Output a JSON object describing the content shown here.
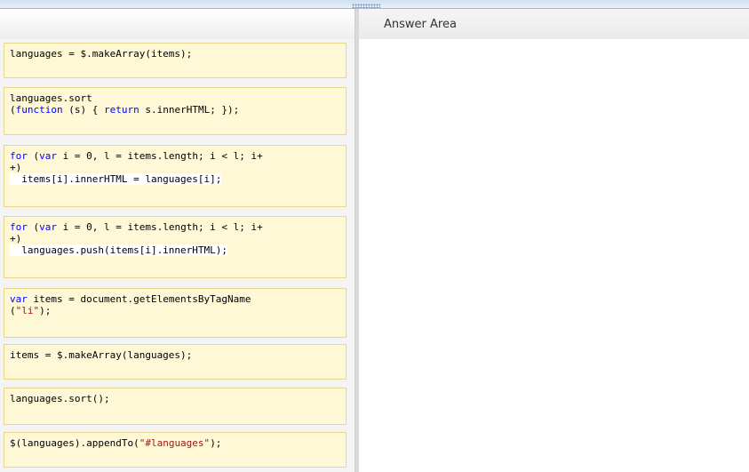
{
  "answer_area": {
    "title": "Answer Area"
  },
  "cards": {
    "c1": {
      "l1": "languages = $.makeArray(items);"
    },
    "c2": {
      "l1": "languages.sort",
      "l2_kw": "function",
      "l2_rest": " (s) { ",
      "l2_kw2": "return",
      "l2_rest2": " s.innerHTML; });"
    },
    "c3": {
      "l1_kw": "for",
      "l1_a": " (",
      "l1_kw2": "var",
      "l1_b": " i = 0, l = items.length; i < l; i+",
      "l2": "+)",
      "l3": "  items[i].innerHTML = languages[i];"
    },
    "c4": {
      "l1_kw": "for",
      "l1_a": " (",
      "l1_kw2": "var",
      "l1_b": " i = 0, l = items.length; i < l; i+",
      "l2": "+)",
      "l3": "  languages.push(items[i].innerHTML);"
    },
    "c5": {
      "l1_kw": "var",
      "l1_rest": " items = document.getElementsByTagName",
      "l2_a": "(",
      "l2_str": "\"li\"",
      "l2_b": ");"
    },
    "c6": {
      "l1": "items = $.makeArray(languages);"
    },
    "c7": {
      "l1": "languages.sort();"
    },
    "c8": {
      "l1_a": "$(languages).appendTo(",
      "l1_str": "\"#languages\"",
      "l1_b": ");"
    }
  }
}
